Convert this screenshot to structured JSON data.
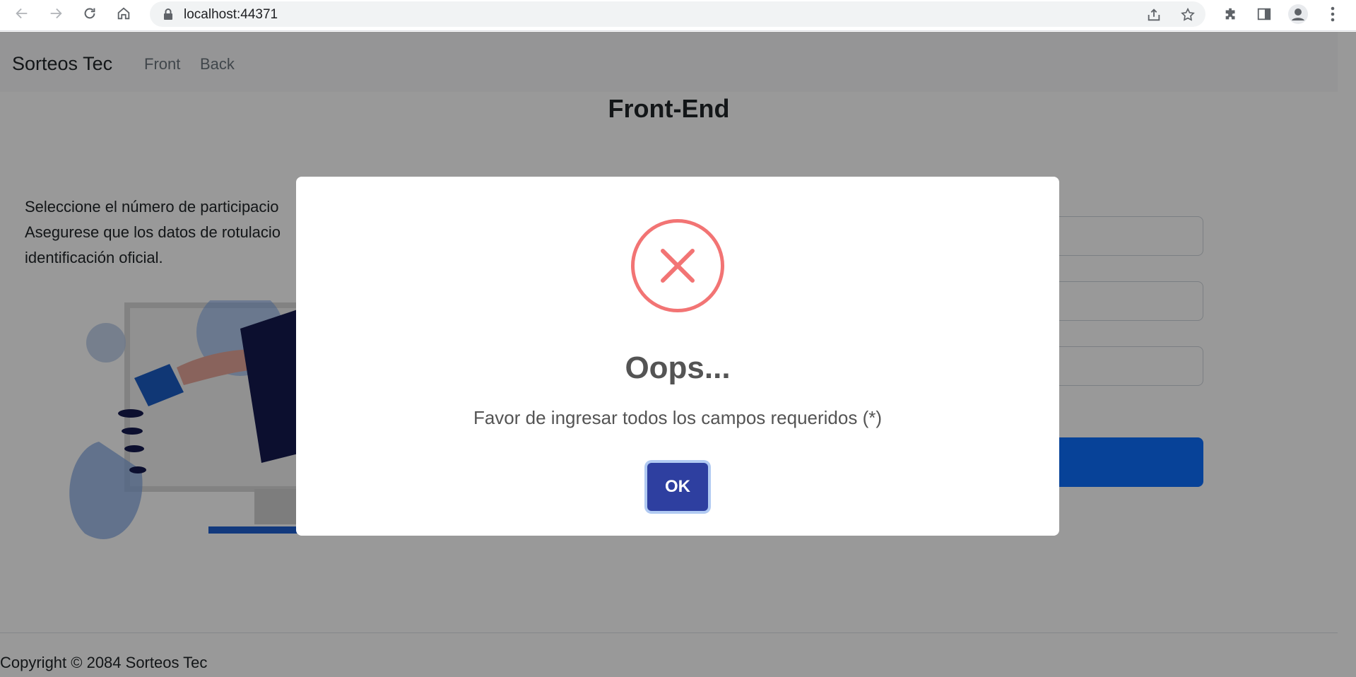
{
  "browser": {
    "url": "localhost:44371"
  },
  "navbar": {
    "brand": "Sorteos Tec",
    "links": [
      "Front",
      "Back"
    ]
  },
  "main": {
    "title": "Front-End",
    "intro_lines": [
      "Seleccione el número de participacio",
      "Asegurese que los datos de rotulacio",
      "identificación oficial."
    ]
  },
  "footer": {
    "text": "Copyright © 2084 Sorteos Tec"
  },
  "dialog": {
    "icon": "error-x-icon",
    "title": "Oops...",
    "message": "Favor de ingresar todos los campos requeridos (*)",
    "ok_label": "OK"
  },
  "colors": {
    "error": "#f27474",
    "ok_button": "#2e3fa0",
    "primary": "#0d6efd"
  }
}
